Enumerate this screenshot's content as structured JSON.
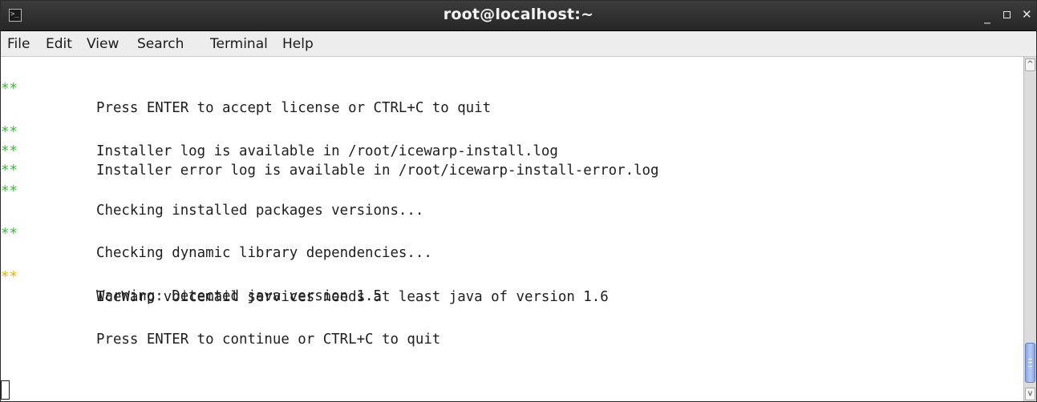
{
  "window": {
    "title": "root@localhost:~",
    "controls": {
      "minimize": "_",
      "close": "✕"
    }
  },
  "menu": {
    "items": [
      "File",
      "Edit",
      "View",
      "Search",
      "Terminal",
      "Help"
    ]
  },
  "terminal": {
    "lines": [
      {
        "marker": "**",
        "marker_color": "green",
        "text": "Press ENTER to accept license or CTRL+C to quit"
      },
      {
        "marker": "",
        "text": ""
      },
      {
        "marker": "**",
        "marker_color": "green",
        "text": "Installer log is available in /root/icewarp-install.log"
      },
      {
        "marker": "**",
        "marker_color": "green",
        "text": "Installer error log is available in /root/icewarp-install-error.log"
      },
      {
        "marker": "**",
        "marker_color": "green",
        "text": ""
      },
      {
        "marker": "**",
        "marker_color": "green",
        "text": "Checking installed packages versions..."
      },
      {
        "marker": "",
        "text": ""
      },
      {
        "marker": "**",
        "marker_color": "green",
        "text": "Checking dynamic library dependencies..."
      },
      {
        "marker": "",
        "text": ""
      },
      {
        "marker": "**",
        "marker_color": "yellow",
        "text": "Warning: Detected java version 1.5"
      },
      {
        "marker": "",
        "text": "IceWarp voicemail services needs at least java of version 1.6"
      },
      {
        "marker": "",
        "text": ""
      },
      {
        "marker": "",
        "text": "Press ENTER to continue or CTRL+C to quit"
      }
    ],
    "colors": {
      "green_marker": "#3db53d",
      "yellow_marker": "#e0b400"
    }
  },
  "scrollbar": {
    "up_arrow": "^",
    "down_arrow": "v",
    "thumb_color": "#8aa7e0"
  }
}
